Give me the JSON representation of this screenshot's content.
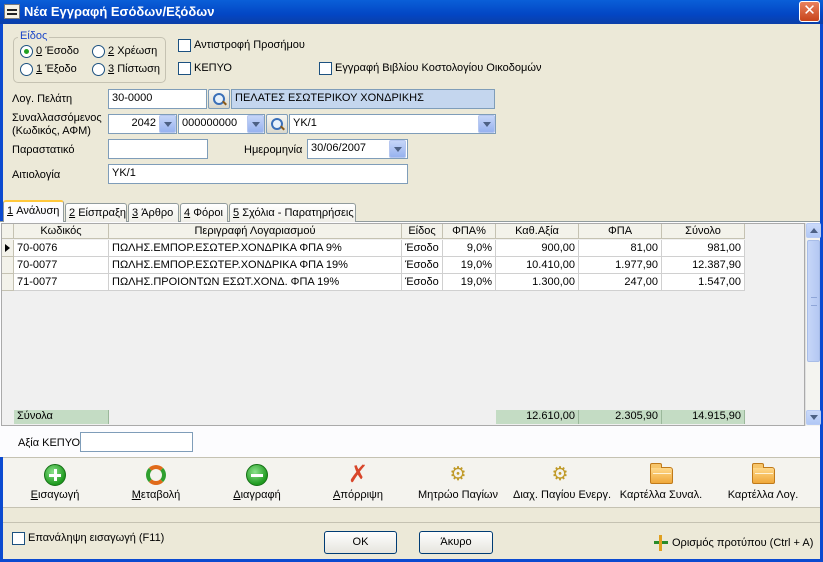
{
  "window": {
    "title": "Νέα Εγγραφή Εσόδων/Εξόδων"
  },
  "type_group": {
    "legend": "Είδος",
    "options": [
      {
        "key": "0",
        "label": "Έσοδο",
        "checked": true
      },
      {
        "key": "2",
        "label": "Χρέωση",
        "checked": false
      },
      {
        "key": "1",
        "label": "Έξοδο",
        "checked": false
      },
      {
        "key": "3",
        "label": "Πίστωση",
        "checked": false
      }
    ]
  },
  "checkboxes": {
    "reverse_sign": "Αντιστροφή Προσήμου",
    "kepyo": "ΚΕΠΥΟ",
    "book_entry": "Εγγραφή Βιβλίου Κοστολογίου Οικοδομών"
  },
  "form": {
    "customer_label": "Λογ. Πελάτη",
    "customer_code": "30-0000",
    "customer_name": "ΠΕΛΑΤΕΣ ΕΣΩΤΕΡΙΚΟΥ ΧΟΝΔΡΙΚΗΣ",
    "counterparty_label_1": "Συναλλασσόμενος",
    "counterparty_label_2": "(Κωδικός, ΑΦΜ)",
    "counterparty_code": "2042",
    "counterparty_afm": "000000000",
    "counterparty_name": "ΥΚ/1",
    "document_label": "Παραστατικό",
    "document_value": "",
    "date_label": "Ημερομηνία",
    "date_value": "30/06/2007",
    "reason_label": "Αιτιολογία",
    "reason_value": "ΥΚ/1"
  },
  "tabs": [
    {
      "key": "1",
      "label": "Ανάλυση",
      "active": true
    },
    {
      "key": "2",
      "label": "Είσπραξη",
      "active": false
    },
    {
      "key": "3",
      "label": "Άρθρο",
      "active": false
    },
    {
      "key": "4",
      "label": "Φόροι",
      "active": false
    },
    {
      "key": "5",
      "label": "Σχόλια - Παρατηρήσεις",
      "active": false
    }
  ],
  "grid": {
    "columns": [
      "Κωδικός",
      "Περιγραφή Λογαριασμού",
      "Είδος",
      "ΦΠΑ%",
      "Καθ.Αξία",
      "ΦΠΑ",
      "Σύνολο"
    ],
    "rows": [
      {
        "code": "70-0076",
        "description": "ΠΩΛΗΣ.ΕΜΠΟΡ.ΕΣΩΤΕΡ.ΧΟΝΔΡΙΚΑ ΦΠΑ 9%",
        "type": "Έσοδο",
        "vat_pct": "9,0%",
        "net": "900,00",
        "vat": "81,00",
        "total": "981,00"
      },
      {
        "code": "70-0077",
        "description": "ΠΩΛΗΣ.ΕΜΠΟΡ.ΕΣΩΤΕΡ.ΧΟΝΔΡΙΚΑ ΦΠΑ 19%",
        "type": "Έσοδο",
        "vat_pct": "19,0%",
        "net": "10.410,00",
        "vat": "1.977,90",
        "total": "12.387,90"
      },
      {
        "code": "71-0077",
        "description": "ΠΩΛΗΣ.ΠΡΟΙΟΝΤΩΝ  ΕΣΩΤ.ΧΟΝΔ. ΦΠΑ 19%",
        "type": "Έσοδο",
        "vat_pct": "19,0%",
        "net": "1.300,00",
        "vat": "247,00",
        "total": "1.547,00"
      }
    ],
    "totals_label": "Σύνολα",
    "totals": {
      "net": "12.610,00",
      "vat": "2.305,90",
      "total": "14.915,90"
    }
  },
  "kepyo_value": {
    "label": "Αξία ΚΕΠΥΟ",
    "value": ""
  },
  "toolbar": [
    {
      "name": "insert",
      "label": "Εισαγωγή",
      "hotkey": "Ε",
      "rest": "ισαγωγή",
      "icon": "add-icon"
    },
    {
      "name": "modify",
      "label": "Μεταβολή",
      "hotkey": "Μ",
      "rest": "εταβολή",
      "icon": "refresh-icon"
    },
    {
      "name": "delete",
      "label": "Διαγραφή",
      "hotkey": "Δ",
      "rest": "ιαγραφή",
      "icon": "remove-icon"
    },
    {
      "name": "reject",
      "label": "Απόρριψη",
      "hotkey": "Α",
      "rest": "πόρριψη",
      "icon": "cancel-x-icon"
    },
    {
      "name": "asset-registry",
      "label": "Μητρώο Παγίων",
      "icon": "gears-icon"
    },
    {
      "name": "asset-management",
      "label": "Διαχ. Παγίου Ενεργ.",
      "icon": "gears-icon"
    },
    {
      "name": "counterparty-card",
      "label": "Καρτέλλα Συναλ.",
      "icon": "folder-icon"
    },
    {
      "name": "account-card",
      "label": "Καρτέλλα Λογ.",
      "icon": "folder-icon"
    }
  ],
  "footer": {
    "repeat_insert": "Επανάληψη εισαγωγή (F11)",
    "ok": "ΟΚ",
    "cancel": "Άκυρο",
    "set_template": "Ορισμός προτύπου (Ctrl + A)"
  },
  "colors": {
    "title_bar": "#0346c4",
    "totals_row": "#c4dcc4",
    "info_field": "#c4d6ee",
    "close_button": "#c8441a"
  }
}
